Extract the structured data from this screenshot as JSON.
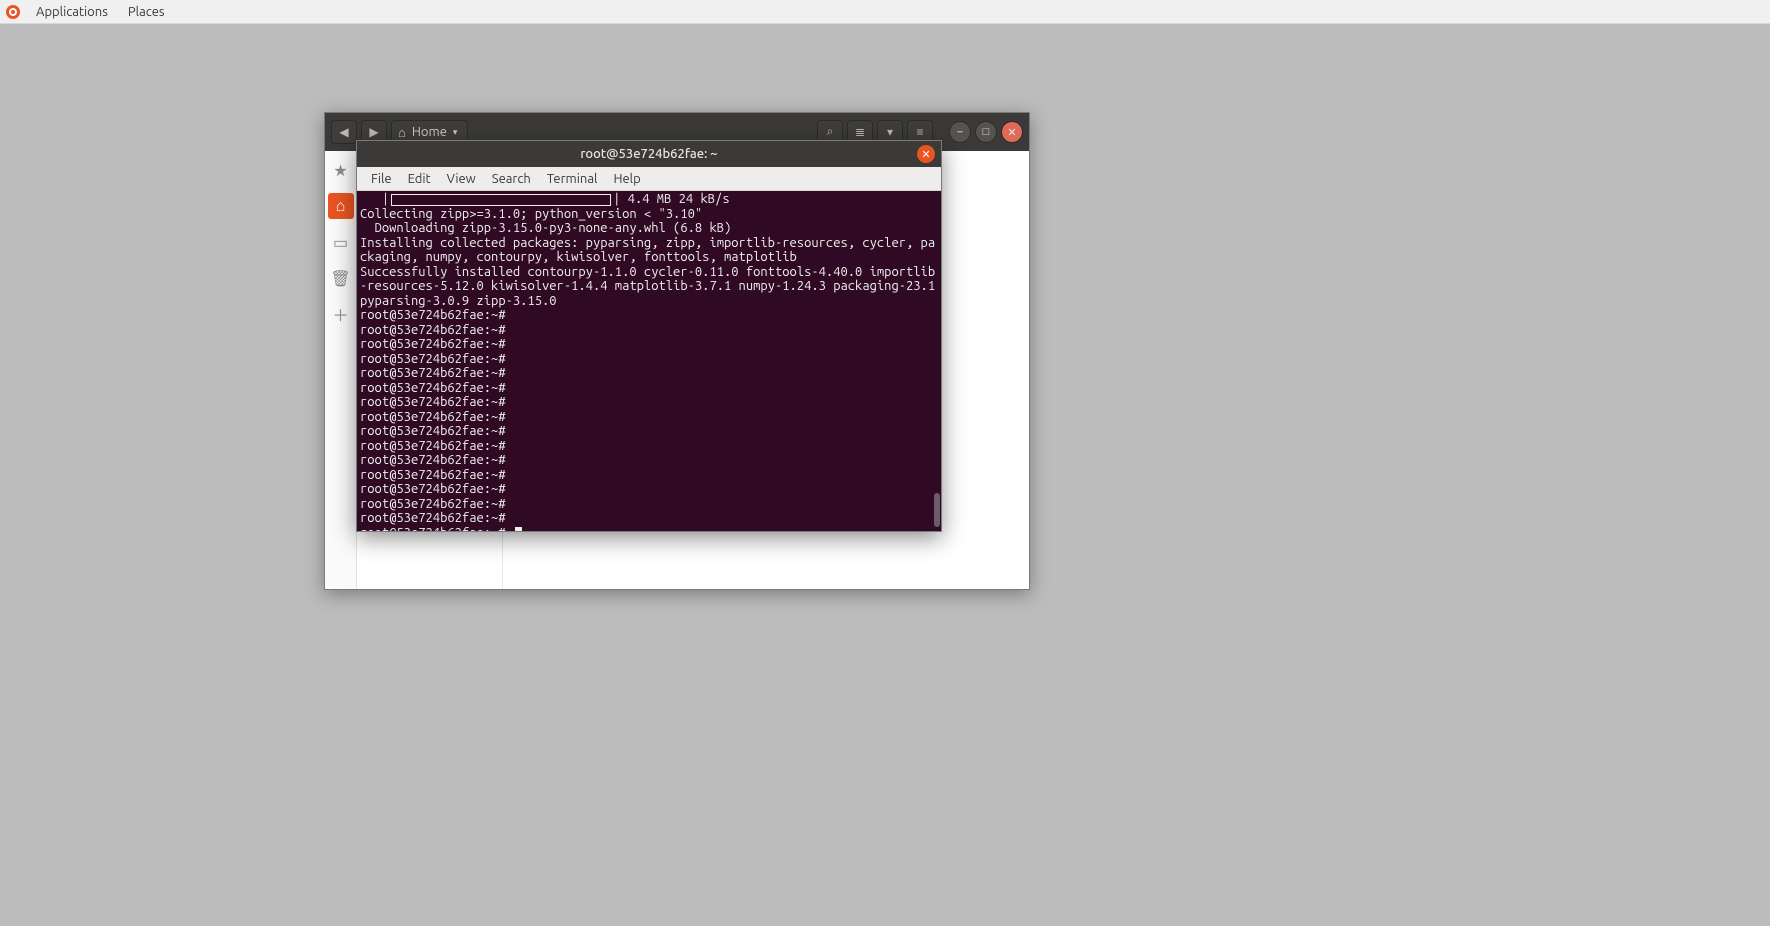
{
  "topbar": {
    "applications": "Applications",
    "places": "Places"
  },
  "filemanager": {
    "location": "Home",
    "sidebar_icons": [
      "star-icon",
      "home-icon",
      "square-icon",
      "trash-icon",
      "plus-icon"
    ]
  },
  "terminal": {
    "title": "root@53e724b62fae: ~",
    "menu": {
      "file": "File",
      "edit": "Edit",
      "view": "View",
      "search": "Search",
      "terminal": "Terminal",
      "help": "Help"
    },
    "progress_suffix": "| 4.4 MB 24 kB/s",
    "output_lines": [
      "Collecting zipp>=3.1.0; python_version < \"3.10\"",
      "  Downloading zipp-3.15.0-py3-none-any.whl (6.8 kB)",
      "Installing collected packages: pyparsing, zipp, importlib-resources, cycler, packaging, numpy, contourpy, kiwisolver, fonttools, matplotlib",
      "Successfully installed contourpy-1.1.0 cycler-0.11.0 fonttools-4.40.0 importlib-resources-5.12.0 kiwisolver-1.4.4 matplotlib-3.7.1 numpy-1.24.3 packaging-23.1 pyparsing-3.0.9 zipp-3.15.0"
    ],
    "prompt": "root@53e724b62fae:~#",
    "empty_prompt_count": 15
  }
}
